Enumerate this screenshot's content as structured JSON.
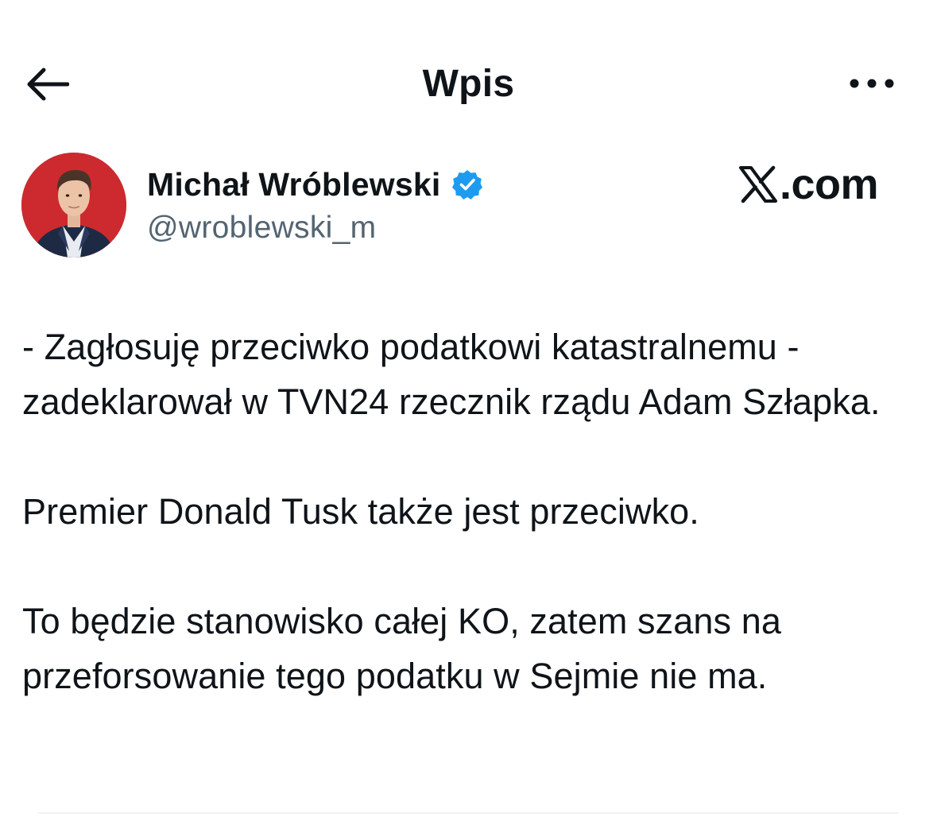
{
  "header": {
    "title": "Wpis",
    "back_icon": "arrow-left-icon",
    "more_icon": "more-horizontal-icon"
  },
  "author": {
    "display_name": "Michał Wróblewski",
    "handle": "@wroblewski_m",
    "verified": true,
    "verified_color": "#1d9bf0",
    "avatar_background": "#cc2a2f"
  },
  "source_badge": {
    "logo": "x-logo",
    "domain": ".com"
  },
  "tweet": {
    "paragraphs": [
      "- Zagłosuję przeciwko podatkowi katastralnemu - zadeklarował w TVN24 rzecznik rządu Adam Szłapka.",
      "Premier Donald Tusk także jest przeciwko.",
      "To będzie stanowisko całej KO, zatem szans na przeforsowanie tego podatku w Sejmie nie ma."
    ]
  },
  "colors": {
    "text_primary": "#0f1419",
    "text_secondary": "#536471",
    "divider": "#eff3f4"
  }
}
